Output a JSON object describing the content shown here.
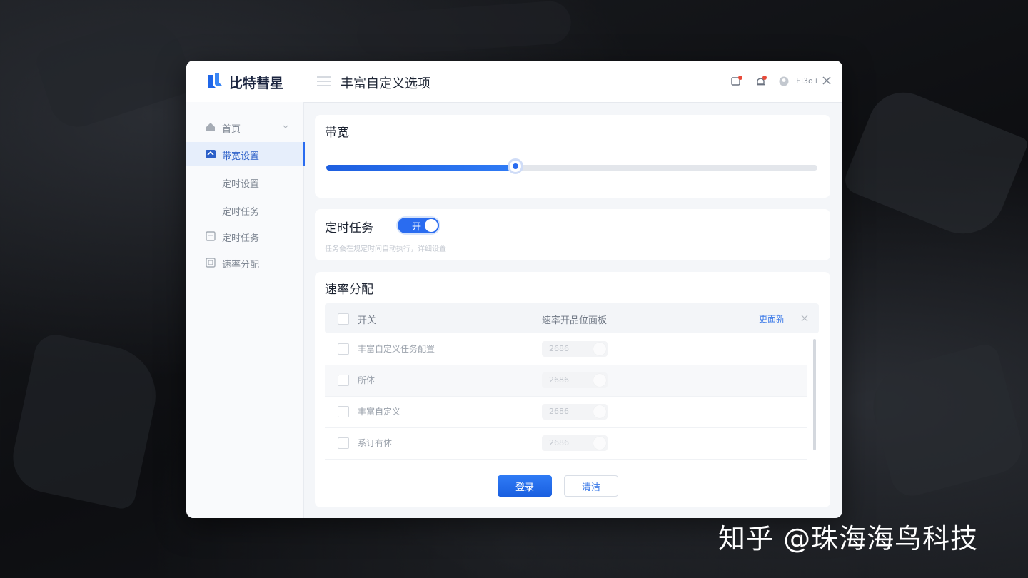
{
  "app": {
    "brand": "比特彗星",
    "page_title": "丰富自定义选项",
    "user_label": "Ei3o+"
  },
  "sidebar": {
    "items": [
      {
        "label": "首页",
        "icon": "home-icon"
      },
      {
        "label": "带宽设置",
        "icon": "bandwidth-icon",
        "active": true
      },
      {
        "label": "定时设置"
      },
      {
        "label": "定时任务"
      },
      {
        "label": "定时任务",
        "icon": "task-icon"
      },
      {
        "label": "速率分配",
        "icon": "allocation-icon"
      }
    ]
  },
  "bandwidth": {
    "title": "带宽",
    "level_fraction": 0.385
  },
  "schedule": {
    "title": "定时任务",
    "toggle_label": "开",
    "toggle_on": true,
    "hint": "任务会在规定时间自动执行，详细设置"
  },
  "rate": {
    "title": "速率分配",
    "columns": {
      "switch": "开关",
      "panel": "速率开品位面板",
      "more": "更面新"
    },
    "rows": [
      {
        "name": "丰富自定义任务配置",
        "value": "2686"
      },
      {
        "name": "所体",
        "value": "2686"
      },
      {
        "name": "丰富自定义",
        "value": "2686"
      },
      {
        "name": "系订有体",
        "value": "2686"
      }
    ],
    "primary_button": "登录",
    "secondary_button": "清洁"
  },
  "watermark": "知乎 @珠海海鸟科技",
  "colors": {
    "accent": "#2a6cf0",
    "background": "#0f1013"
  }
}
